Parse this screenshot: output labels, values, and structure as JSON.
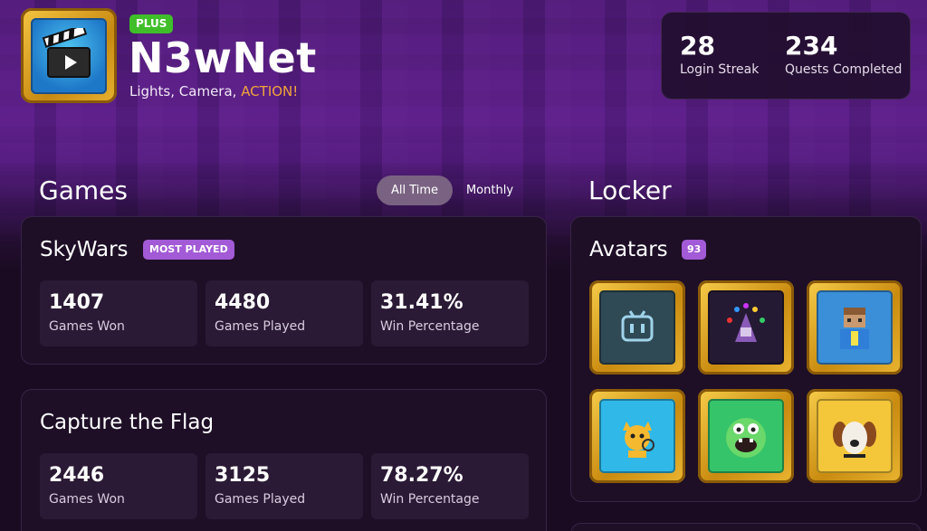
{
  "profile": {
    "badge": "PLUS",
    "username": "N3wNet",
    "tagline_prefix": "Lights, Camera, ",
    "tagline_accent": "ACTION!",
    "avatar_icon": "clapperboard-icon"
  },
  "header_stats": [
    {
      "value": "28",
      "label": "Login Streak"
    },
    {
      "value": "234",
      "label": "Quests Completed"
    }
  ],
  "games": {
    "title": "Games",
    "toggle": {
      "options": [
        "All Time",
        "Monthly"
      ],
      "selected": "All Time"
    },
    "cards": [
      {
        "name": "SkyWars",
        "badge": "MOST PLAYED",
        "stats": [
          {
            "value": "1407",
            "label": "Games Won"
          },
          {
            "value": "4480",
            "label": "Games Played"
          },
          {
            "value": "31.41%",
            "label": "Win Percentage"
          }
        ]
      },
      {
        "name": "Capture the Flag",
        "stats": [
          {
            "value": "2446",
            "label": "Games Won"
          },
          {
            "value": "3125",
            "label": "Games Played"
          },
          {
            "value": "78.27%",
            "label": "Win Percentage"
          }
        ]
      }
    ]
  },
  "locker": {
    "title": "Locker",
    "section": "Avatars",
    "count": "93",
    "avatars": [
      {
        "icon": "robot-icon",
        "bg": "#2f4a55"
      },
      {
        "icon": "wizard-icon",
        "bg": "#251a33"
      },
      {
        "icon": "blocky-player-icon",
        "bg": "#3a8fd8"
      },
      {
        "icon": "detective-cat-icon",
        "bg": "#2fb8e8"
      },
      {
        "icon": "green-monster-icon",
        "bg": "#35c46a"
      },
      {
        "icon": "dog-icon",
        "bg": "#f4c63a"
      }
    ]
  },
  "colors": {
    "accent_orange": "#f2a53a",
    "plus_green": "#3fbe2a",
    "badge_purple": "#a25ad6",
    "gold_frame": "#e8b230"
  }
}
